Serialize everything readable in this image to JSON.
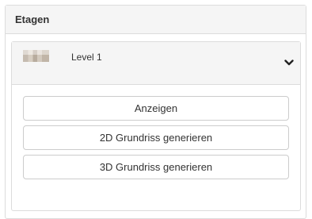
{
  "panel": {
    "title": "Etagen"
  },
  "level": {
    "name": "Level 1",
    "expanded": true,
    "toggle_icon": "chevron-down-icon",
    "thumbnail": "floor-thumbnail"
  },
  "actions": [
    {
      "label": "Anzeigen"
    },
    {
      "label": "2D Grundriss generieren"
    },
    {
      "label": "3D Grundriss generieren"
    }
  ]
}
